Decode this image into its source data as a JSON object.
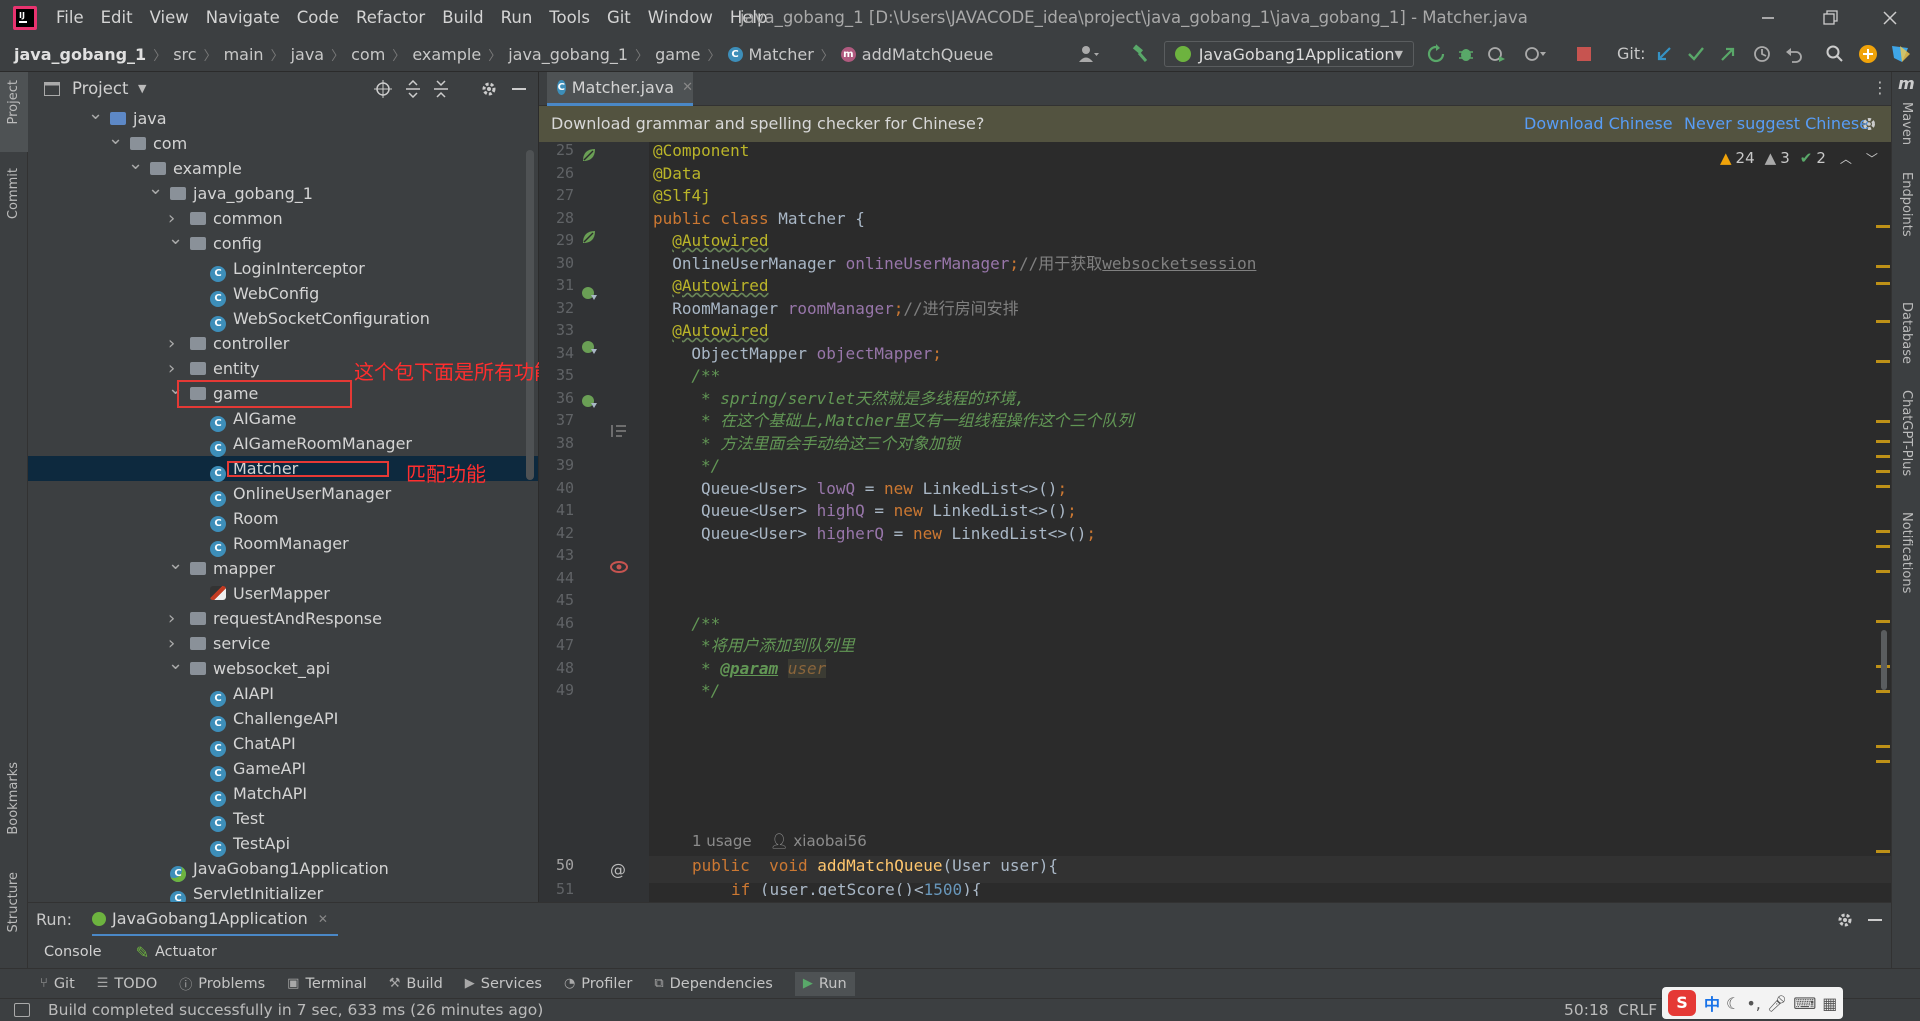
{
  "menu": [
    "File",
    "Edit",
    "View",
    "Navigate",
    "Code",
    "Refactor",
    "Build",
    "Run",
    "Tools",
    "Git",
    "Window",
    "Help"
  ],
  "window_title": "java_gobang_1 [D:\\Users\\JAVACODE_idea\\project\\java_gobang_1\\java_gobang_1] - Matcher.java",
  "breadcrumbs": [
    "java_gobang_1",
    "src",
    "main",
    "java",
    "com",
    "example",
    "java_gobang_1",
    "game",
    "Matcher",
    "addMatchQueue"
  ],
  "run_config": "JavaGobang1Application",
  "git_label": "Git:",
  "left_strip": {
    "project": "Project",
    "commit": "Commit",
    "bookmarks": "Bookmarks",
    "structure": "Structure"
  },
  "right_strip": {
    "maven": "Maven",
    "endpoints": "Endpoints",
    "database": "Database",
    "chatgpt": "ChatGPT-Plus",
    "notifications": "Notifications"
  },
  "project_panel": {
    "title": "Project"
  },
  "tree": [
    {
      "label": "java",
      "kind": "folder-blue",
      "expanded": true
    },
    {
      "label": "com",
      "kind": "folder",
      "expanded": true
    },
    {
      "label": "example",
      "kind": "folder",
      "expanded": true
    },
    {
      "label": "java_gobang_1",
      "kind": "folder",
      "expanded": true
    },
    {
      "label": "common",
      "kind": "folder",
      "expanded": false
    },
    {
      "label": "config",
      "kind": "folder",
      "expanded": true
    },
    {
      "label": "LoginInterceptor",
      "kind": "class"
    },
    {
      "label": "WebConfig",
      "kind": "class"
    },
    {
      "label": "WebSocketConfiguration",
      "kind": "class"
    },
    {
      "label": "controller",
      "kind": "folder",
      "expanded": false
    },
    {
      "label": "entity",
      "kind": "folder",
      "expanded": false
    },
    {
      "label": "game",
      "kind": "folder",
      "expanded": true
    },
    {
      "label": "AIGame",
      "kind": "class"
    },
    {
      "label": "AIGameRoomManager",
      "kind": "class"
    },
    {
      "label": "Matcher",
      "kind": "class"
    },
    {
      "label": "OnlineUserManager",
      "kind": "class"
    },
    {
      "label": "Room",
      "kind": "class"
    },
    {
      "label": "RoomManager",
      "kind": "class"
    },
    {
      "label": "mapper",
      "kind": "folder",
      "expanded": true
    },
    {
      "label": "UserMapper",
      "kind": "mapper"
    },
    {
      "label": "requestAndResponse",
      "kind": "folder",
      "expanded": false
    },
    {
      "label": "service",
      "kind": "folder",
      "expanded": false
    },
    {
      "label": "websocket_api",
      "kind": "folder",
      "expanded": true
    },
    {
      "label": "AIAPI",
      "kind": "class"
    },
    {
      "label": "ChallengeAPI",
      "kind": "class"
    },
    {
      "label": "ChatAPI",
      "kind": "class"
    },
    {
      "label": "GameAPI",
      "kind": "class"
    },
    {
      "label": "MatchAPI",
      "kind": "class"
    },
    {
      "label": "Test",
      "kind": "class"
    },
    {
      "label": "TestApi",
      "kind": "class"
    },
    {
      "label": "JavaGobang1Application",
      "kind": "app"
    },
    {
      "label": "ServletInitializer",
      "kind": "class"
    }
  ],
  "annotations": {
    "game_note": "这个包下面是所有功能处理的核心",
    "matcher_note": "匹配功能"
  },
  "editor": {
    "tab": "Matcher.java",
    "banner": "Download grammar and spelling checker for Chinese?",
    "banner_download": "Download Chinese",
    "banner_never": "Never suggest Chinese",
    "inspections": {
      "warnings": "24",
      "weak": "3",
      "ok": "2"
    },
    "line_numbers": [
      "25",
      "26",
      "27",
      "28",
      "29",
      "30",
      "31",
      "32",
      "33",
      "34",
      "35",
      "36",
      "37",
      "38",
      "39",
      "40",
      "41",
      "42",
      "43",
      "44",
      "45",
      "46",
      "47",
      "48",
      "49",
      "",
      "50",
      "51"
    ],
    "usage_hint": "1 usage",
    "author_hint": "xiaobai56"
  },
  "run_panel": {
    "label": "Run:",
    "tab": "JavaGobang1Application",
    "console": "Console",
    "actuator": "Actuator"
  },
  "bottom_tools": [
    "Git",
    "TODO",
    "Problems",
    "Terminal",
    "Build",
    "Services",
    "Profiler",
    "Dependencies",
    "Run"
  ],
  "status": {
    "message": "Build completed successfully in 7 sec, 633 ms (26 minutes ago)",
    "position": "50:18",
    "line_sep": "CRLF"
  }
}
